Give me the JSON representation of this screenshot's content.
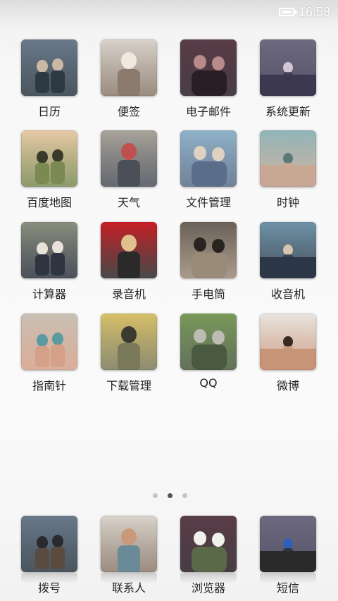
{
  "status": {
    "time": "16:58",
    "battery_icon": "battery-full-icon"
  },
  "apps": [
    {
      "label": "日历",
      "icon": "calendar-icon",
      "colors": [
        "#6a7a8c",
        "#2d3a44",
        "#c9b9a4"
      ]
    },
    {
      "label": "便签",
      "icon": "notes-icon",
      "colors": [
        "#d9d3cb",
        "#8c7a6d",
        "#f1e8de"
      ]
    },
    {
      "label": "电子邮件",
      "icon": "email-icon",
      "colors": [
        "#5a3d48",
        "#2a1d26",
        "#b88a8a"
      ]
    },
    {
      "label": "系统更新",
      "icon": "system-update-icon",
      "colors": [
        "#6f6a80",
        "#3b3850",
        "#d2c6d4"
      ]
    },
    {
      "label": "百度地图",
      "icon": "baidu-map-icon",
      "colors": [
        "#e8c9a8",
        "#7a8a52",
        "#3a3a2a"
      ]
    },
    {
      "label": "天气",
      "icon": "weather-icon",
      "colors": [
        "#a9a39a",
        "#4b5058",
        "#c0504d"
      ]
    },
    {
      "label": "文件管理",
      "icon": "file-manager-icon",
      "colors": [
        "#8fb2c8",
        "#5a6e8a",
        "#e0d2c2"
      ]
    },
    {
      "label": "时钟",
      "icon": "clock-icon",
      "colors": [
        "#8fb5b8",
        "#c8a894",
        "#5a7a78"
      ]
    },
    {
      "label": "计算器",
      "icon": "calculator-icon",
      "colors": [
        "#8a8f7e",
        "#2e3440",
        "#e8e2d8"
      ]
    },
    {
      "label": "录音机",
      "icon": "recorder-icon",
      "colors": [
        "#c81f25",
        "#2a2a2a",
        "#e0c08c"
      ]
    },
    {
      "label": "手电筒",
      "icon": "flashlight-icon",
      "colors": [
        "#6a6058",
        "#9a8a78",
        "#2a2420"
      ]
    },
    {
      "label": "收音机",
      "icon": "radio-icon",
      "colors": [
        "#6f93a8",
        "#2c3848",
        "#d8c4b0"
      ]
    },
    {
      "label": "指南针",
      "icon": "compass-icon",
      "colors": [
        "#c8c0b4",
        "#d4a088",
        "#5a9aa0"
      ]
    },
    {
      "label": "下载管理",
      "icon": "download-manager-icon",
      "colors": [
        "#d8c068",
        "#7a7a5a",
        "#3a3a30"
      ]
    },
    {
      "label": "QQ",
      "icon": "qq-icon",
      "colors": [
        "#7a9a5a",
        "#4a5a40",
        "#bcbcb4"
      ]
    },
    {
      "label": "微博",
      "icon": "weibo-icon",
      "colors": [
        "#e8e4e0",
        "#c89478",
        "#3a2a24"
      ]
    }
  ],
  "page_indicator": {
    "count": 3,
    "active": 2
  },
  "dock": [
    {
      "label": "拨号",
      "icon": "dialer-icon",
      "colors": [
        "#8aa0b4",
        "#5a4a40",
        "#2a2a30"
      ]
    },
    {
      "label": "联系人",
      "icon": "contacts-icon",
      "colors": [
        "#b8c4c8",
        "#6a8a98",
        "#c89a7a"
      ]
    },
    {
      "label": "浏览器",
      "icon": "browser-icon",
      "colors": [
        "#c8d4b4",
        "#5a6a48",
        "#f0f0ec"
      ]
    },
    {
      "label": "短信",
      "icon": "sms-icon",
      "colors": [
        "#e4e4e4",
        "#2a2a2a",
        "#2e62b8"
      ]
    }
  ]
}
